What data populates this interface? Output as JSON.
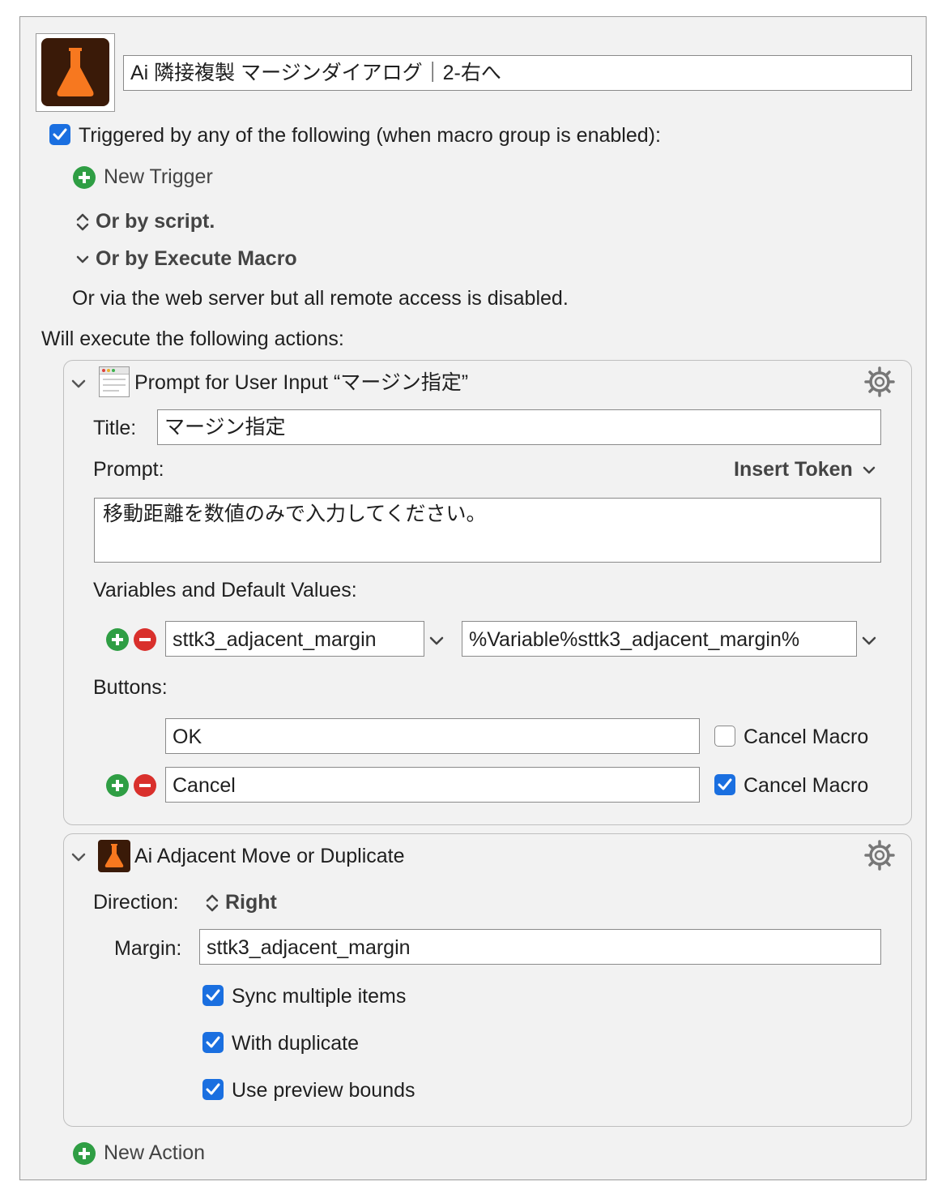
{
  "macro": {
    "name": "Ai 隣接複製 マージンダイアログ｜2-右へ",
    "icon": "flask-icon",
    "trigger_header": "Triggered by any of the following (when macro group is enabled):",
    "new_trigger": "New Trigger",
    "or_by_script": "Or by script.",
    "or_by_execute_macro": "Or by Execute Macro",
    "web_server_note": "Or via the web server but all remote access is disabled.",
    "actions_header": "Will execute the following actions:",
    "new_action": "New Action"
  },
  "action_prompt": {
    "header": "Prompt for User Input “マージン指定”",
    "icon": "window-icon",
    "title_label": "Title:",
    "title_value": "マージン指定",
    "prompt_label": "Prompt:",
    "insert_token": "Insert Token",
    "prompt_text": "移動距離を数値のみで入力してください。",
    "variables_label": "Variables and Default Values:",
    "variable_name": "sttk3_adjacent_margin",
    "variable_default": "%Variable%sttk3_adjacent_margin%",
    "buttons_label": "Buttons:",
    "buttons": [
      {
        "label": "OK",
        "cancel_label": "Cancel Macro",
        "cancel_checked": false
      },
      {
        "label": "Cancel",
        "cancel_label": "Cancel Macro",
        "cancel_checked": true
      }
    ]
  },
  "action_adjacent": {
    "header": "Ai Adjacent Move or Duplicate",
    "icon": "flask-icon",
    "direction_label": "Direction:",
    "direction_value": "Right",
    "margin_label": "Margin:",
    "margin_value": "sttk3_adjacent_margin",
    "options": [
      {
        "label": "Sync multiple items",
        "checked": true
      },
      {
        "label": "With duplicate",
        "checked": true
      },
      {
        "label": "Use preview bounds",
        "checked": true
      }
    ]
  },
  "colors": {
    "accent_blue": "#1a6fe0",
    "add_green": "#2f9e44",
    "remove_red": "#d9302c",
    "flask_orange": "#f7781f",
    "icon_bg": "#3a1a08"
  }
}
